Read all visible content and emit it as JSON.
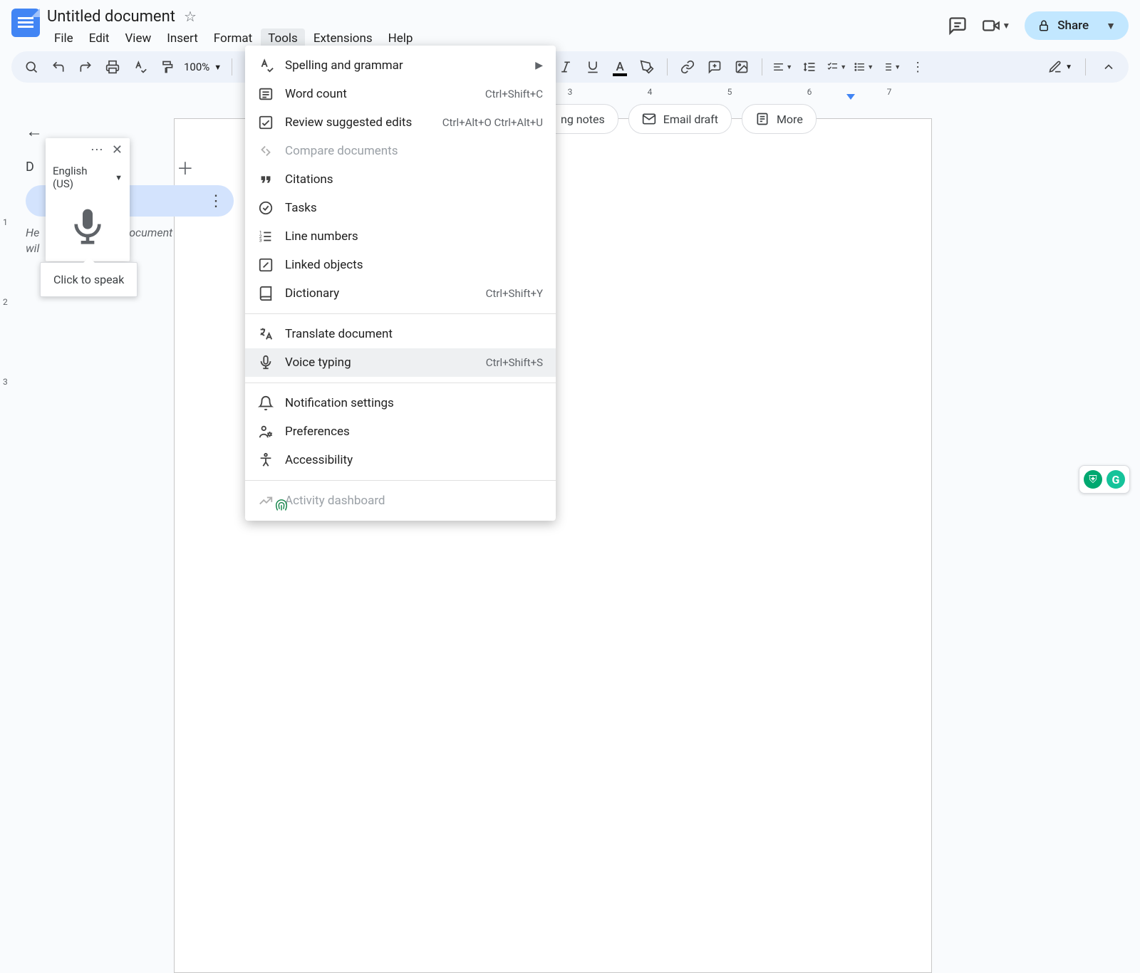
{
  "header": {
    "doc_title": "Untitled document",
    "menubar": [
      "File",
      "Edit",
      "View",
      "Insert",
      "Format",
      "Tools",
      "Extensions",
      "Help"
    ],
    "share_label": "Share"
  },
  "toolbar": {
    "zoom_label": "100%"
  },
  "ruler": {
    "numbers": [
      3,
      4,
      5,
      6,
      7
    ]
  },
  "vruler": {
    "numbers": [
      1,
      2,
      3
    ]
  },
  "outline": {
    "tab_label": "D",
    "help_line1": "He",
    "help_line2": "o the document",
    "help_line3": "wil"
  },
  "voice": {
    "language": "English (US)",
    "tooltip": "Click to speak"
  },
  "chips": {
    "notes_partial": "ng notes",
    "email_draft": "Email draft",
    "more": "More"
  },
  "tools_menu": [
    {
      "id": "spelling",
      "label": "Spelling and grammar",
      "shortcut": "",
      "submenu": true
    },
    {
      "id": "wordcount",
      "label": "Word count",
      "shortcut": "Ctrl+Shift+C"
    },
    {
      "id": "review",
      "label": "Review suggested edits",
      "shortcut": "Ctrl+Alt+O Ctrl+Alt+U"
    },
    {
      "id": "compare",
      "label": "Compare documents",
      "disabled": true
    },
    {
      "id": "citations",
      "label": "Citations"
    },
    {
      "id": "tasks",
      "label": "Tasks"
    },
    {
      "id": "linenum",
      "label": "Line numbers"
    },
    {
      "id": "linked",
      "label": "Linked objects"
    },
    {
      "id": "dict",
      "label": "Dictionary",
      "shortcut": "Ctrl+Shift+Y"
    },
    {
      "divider": true
    },
    {
      "id": "translate",
      "label": "Translate document"
    },
    {
      "id": "voice",
      "label": "Voice typing",
      "shortcut": "Ctrl+Shift+S",
      "hovered": true
    },
    {
      "divider": true
    },
    {
      "id": "notif",
      "label": "Notification settings"
    },
    {
      "id": "prefs",
      "label": "Preferences"
    },
    {
      "id": "a11y",
      "label": "Accessibility"
    },
    {
      "divider": true
    },
    {
      "id": "activity",
      "label": "Activity dashboard",
      "disabled": true
    }
  ]
}
